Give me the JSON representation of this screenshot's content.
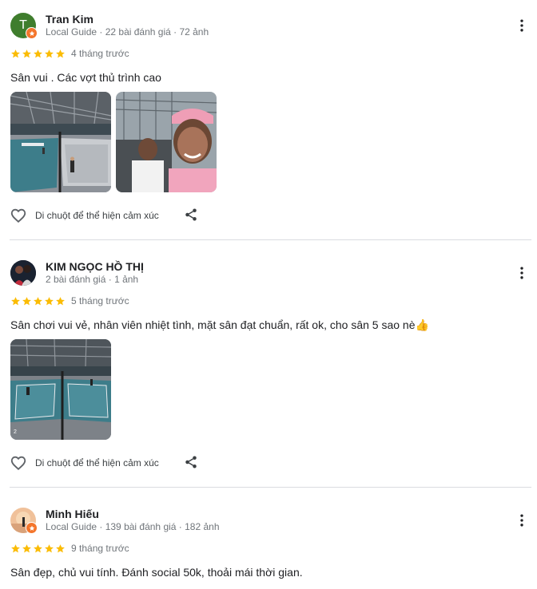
{
  "reviews": [
    {
      "name": "Tran Kim",
      "avatar_letter": "T",
      "meta": "Local Guide · 22 bài đánh giá · 72 ảnh",
      "rating": 5,
      "time": "4 tháng trước",
      "text": "Sân vui . Các vợt thủ trình cao",
      "like_label": "Di chuột để thể hiện cảm xúc"
    },
    {
      "name": "KIM NGỌC HỒ THỊ",
      "meta": "2 bài đánh giá · 1 ảnh",
      "rating": 5,
      "time": "5 tháng trước",
      "text": "Sân chơi vui vẻ, nhân viên nhiệt tình, mặt sân đạt chuẩn, rất ok, cho sân 5 sao nè👍",
      "like_label": "Di chuột để thể hiện cảm xúc"
    },
    {
      "name": "Minh Hiếu",
      "meta": "Local Guide · 139 bài đánh giá · 182 ảnh",
      "rating": 5,
      "time": "9 tháng trước",
      "text": "Sân đẹp, chủ vui tính. Đánh social 50k, thoải mái thời gian."
    }
  ],
  "colors": {
    "star": "#fbbc04",
    "badge": "#f4752b",
    "court": "#3d7d8a",
    "divider": "#dadce0"
  },
  "icons": {
    "more": "more-vert-icon",
    "like": "heart-outline-icon",
    "share": "share-icon",
    "star": "star-icon",
    "badge": "local-guide-badge-icon"
  }
}
